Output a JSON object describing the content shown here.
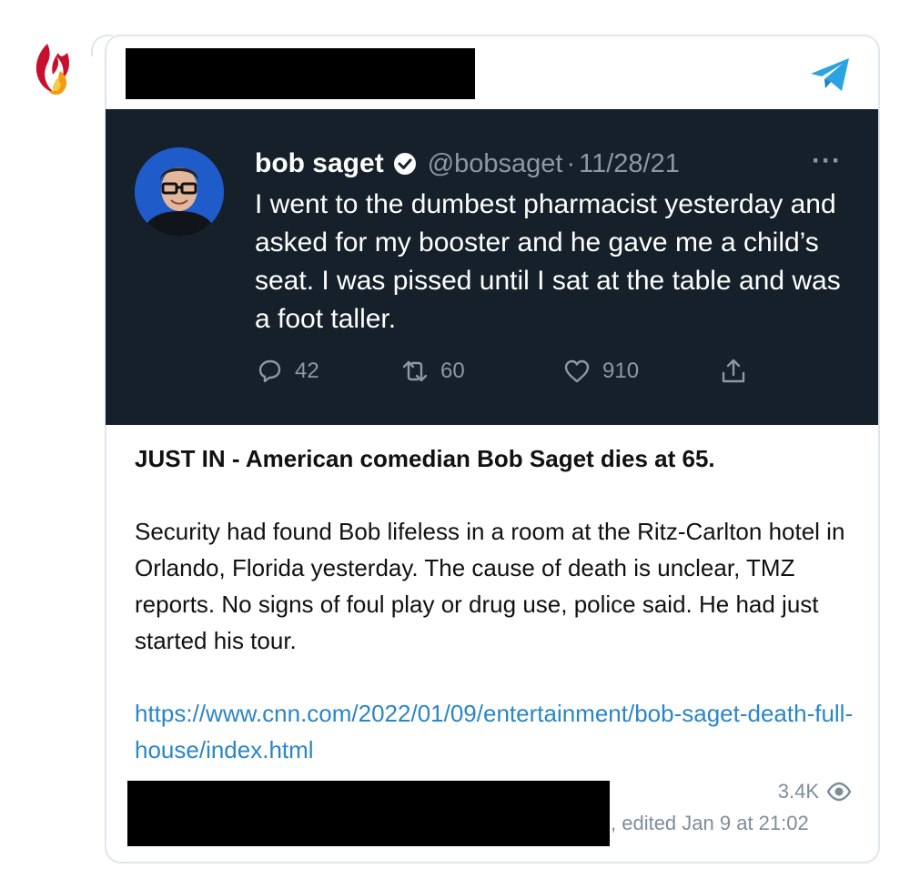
{
  "channel": {
    "avatar_icon": "flame-logo-icon",
    "share_icon": "telegram-share-icon"
  },
  "tweet": {
    "author_name": "bob saget",
    "verified_icon": "verified-badge-icon",
    "handle": "@bobsaget",
    "separator": "·",
    "date": "11/28/21",
    "more_label": "···",
    "text": "I went to the dumbest pharmacist yesterday and asked for my booster and he gave me a child’s seat. I was pissed until I sat at the table and was a foot taller.",
    "replies": "42",
    "retweets": "60",
    "likes": "910"
  },
  "message": {
    "headline": "JUST IN - American comedian Bob Saget dies at 65.",
    "body": "Security had found Bob lifeless in a room at the Ritz-Carlton hotel in Orlando, Florida yesterday. The cause of death is unclear, TMZ reports. No signs of foul play or drug use, police said. He had just started his tour.",
    "link": "https://www.cnn.com/2022/01/09/entertainment/bob-saget-death-full-house/index.html"
  },
  "footer": {
    "views": "3.4K",
    "edited": ", edited  Jan 9 at 21:02"
  },
  "colors": {
    "tweet_background": "#15202b",
    "link": "#2a86c6",
    "telegram_blue": "#2aa3e0",
    "meta_gray": "#7e8d9b"
  }
}
